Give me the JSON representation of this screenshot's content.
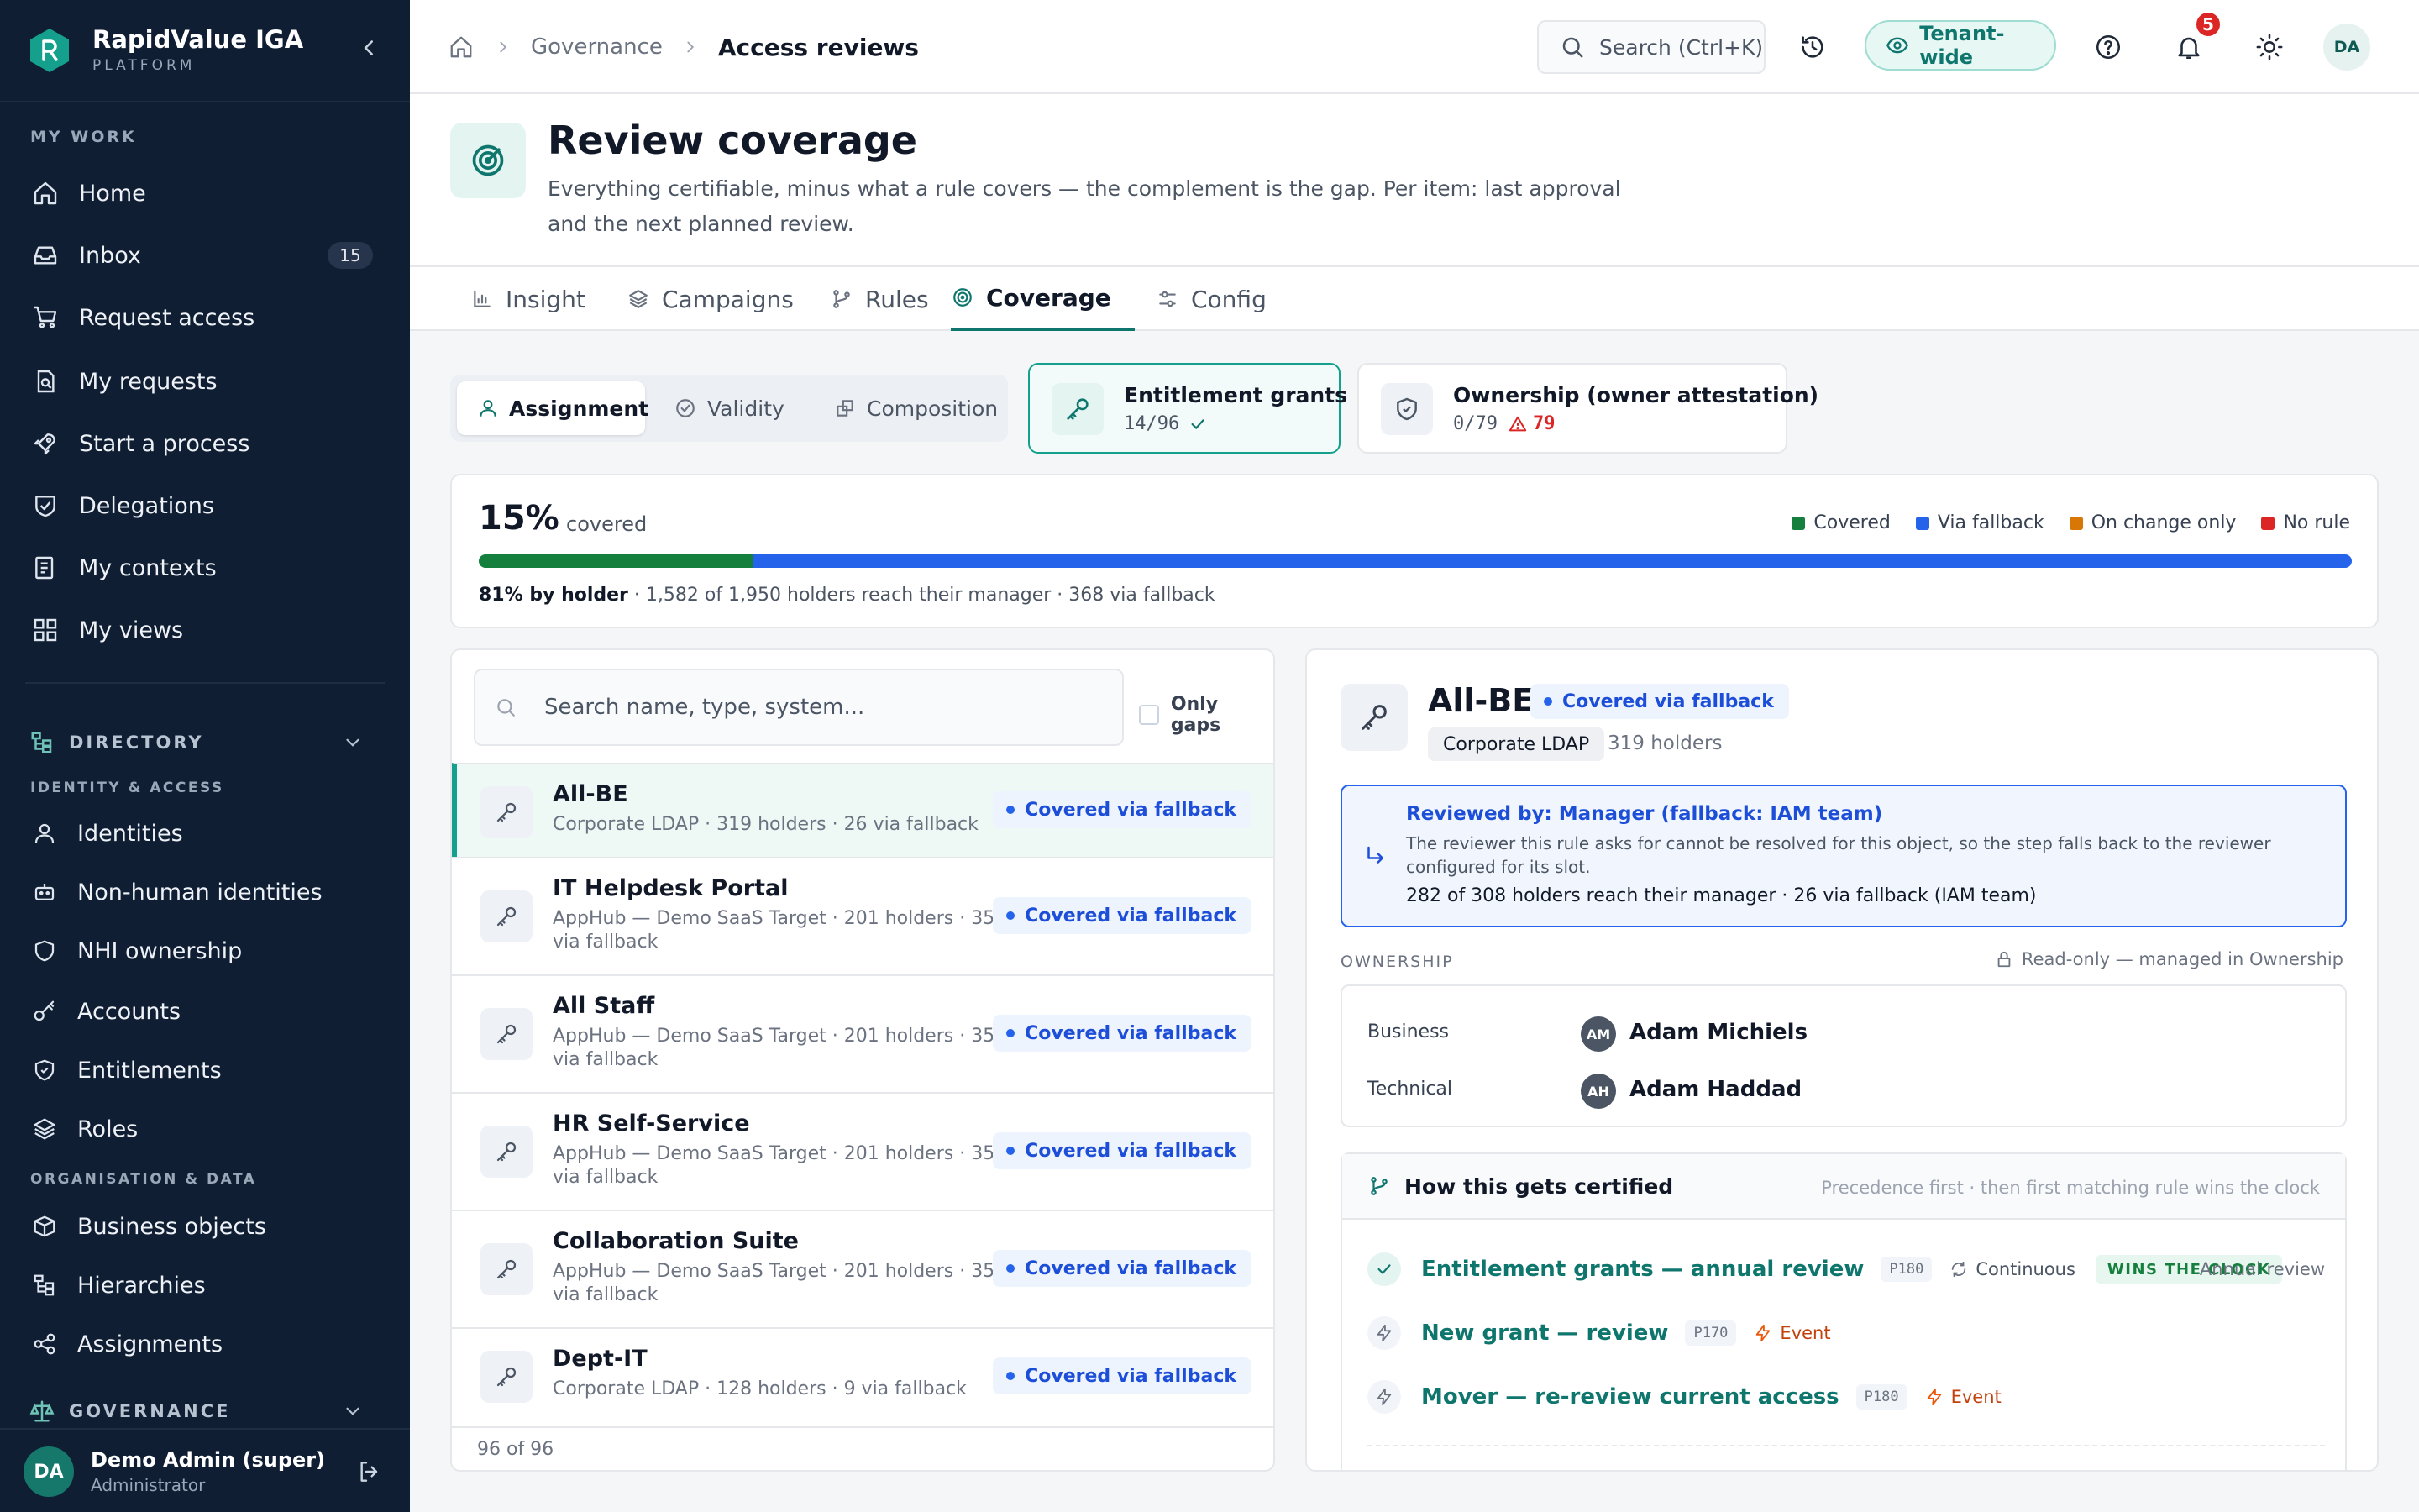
{
  "brand": {
    "name": "RapidValue IGA",
    "sub": "PLATFORM"
  },
  "sidebar": {
    "my_work_label": "MY WORK",
    "my_work": [
      {
        "label": "Home",
        "icon": "home-icon"
      },
      {
        "label": "Inbox",
        "icon": "inbox-icon",
        "badge": "15"
      },
      {
        "label": "Request access",
        "icon": "cart-icon"
      },
      {
        "label": "My requests",
        "icon": "requests-icon"
      },
      {
        "label": "Start a process",
        "icon": "rocket-icon"
      },
      {
        "label": "Delegations",
        "icon": "handshake-icon"
      },
      {
        "label": "My contexts",
        "icon": "contexts-icon"
      },
      {
        "label": "My views",
        "icon": "grid-icon"
      }
    ],
    "directory_label": "DIRECTORY",
    "identity_access_label": "IDENTITY & ACCESS",
    "identity_access": [
      {
        "label": "Identities",
        "icon": "user-icon"
      },
      {
        "label": "Non-human identities",
        "icon": "bot-icon"
      },
      {
        "label": "NHI ownership",
        "icon": "shield-icon"
      },
      {
        "label": "Accounts",
        "icon": "key-icon"
      },
      {
        "label": "Entitlements",
        "icon": "shield-check-icon"
      },
      {
        "label": "Roles",
        "icon": "layers-icon"
      }
    ],
    "org_data_label": "ORGANISATION & DATA",
    "org_data": [
      {
        "label": "Business objects",
        "icon": "box-icon"
      },
      {
        "label": "Hierarchies",
        "icon": "hierarchy-icon"
      },
      {
        "label": "Assignments",
        "icon": "share-icon"
      }
    ],
    "governance_label": "GOVERNANCE",
    "user": {
      "initials": "DA",
      "name": "Demo Admin (super)",
      "role": "Administrator"
    }
  },
  "topbar": {
    "breadcrumb": {
      "parent": "Governance",
      "current": "Access reviews"
    },
    "search_label": "Search (Ctrl+K)",
    "tenant_label": "Tenant-wide",
    "notifications_count": "5",
    "avatar_initials": "DA"
  },
  "page": {
    "title": "Review coverage",
    "description": "Everything certifiable, minus what a rule covers — the complement is the gap. Per item: last approval and the next planned review."
  },
  "tabs": [
    {
      "label": "Insight",
      "icon": "bar-chart-icon"
    },
    {
      "label": "Campaigns",
      "icon": "layers-icon"
    },
    {
      "label": "Rules",
      "icon": "branch-icon"
    },
    {
      "label": "Coverage",
      "icon": "target-icon",
      "active": true
    },
    {
      "label": "Config",
      "icon": "sliders-icon"
    }
  ],
  "segment": [
    {
      "label": "Assignment",
      "icon": "user-icon",
      "active": true
    },
    {
      "label": "Validity",
      "icon": "check-circle-icon"
    },
    {
      "label": "Composition",
      "icon": "composition-icon"
    }
  ],
  "cards": {
    "entitlement": {
      "title": "Entitlement grants",
      "value": "14/96"
    },
    "ownership": {
      "title": "Ownership (owner attestation)",
      "value": "0/79",
      "warn": "79"
    }
  },
  "coverage": {
    "percent": "15%",
    "percent_label": "covered",
    "covered_fraction": 0.146,
    "fallback_fraction": 0.854,
    "legend": [
      {
        "label": "Covered",
        "color": "#15803d"
      },
      {
        "label": "Via fallback",
        "color": "#2563eb"
      },
      {
        "label": "On change only",
        "color": "#d97706"
      },
      {
        "label": "No rule",
        "color": "#dc2626"
      }
    ],
    "by_holder": "81% by holder",
    "footnote": " · 1,582 of 1,950 holders reach their manager · 368 via fallback"
  },
  "list": {
    "search_placeholder": "Search name, type, system...",
    "only_gaps_label": "Only gaps",
    "rows": [
      {
        "name": "All-BE",
        "sub": "Corporate LDAP · 319 holders · 26 via fallback",
        "status": "Covered via fallback"
      },
      {
        "name": "IT Helpdesk Portal",
        "sub": "AppHub — Demo SaaS Target · 201 holders · 35 via fallback",
        "status": "Covered via fallback"
      },
      {
        "name": "All Staff",
        "sub": "AppHub — Demo SaaS Target · 201 holders · 35 via fallback",
        "status": "Covered via fallback"
      },
      {
        "name": "HR Self-Service",
        "sub": "AppHub — Demo SaaS Target · 201 holders · 35 via fallback",
        "status": "Covered via fallback"
      },
      {
        "name": "Collaboration Suite",
        "sub": "AppHub — Demo SaaS Target · 201 holders · 35 via fallback",
        "status": "Covered via fallback"
      },
      {
        "name": "Dept-IT",
        "sub": "Corporate LDAP · 128 holders · 9 via fallback",
        "status": "Covered via fallback"
      }
    ],
    "footer": "96 of 96"
  },
  "detail": {
    "name": "All-BE",
    "status": "Covered via fallback",
    "system": "Corporate LDAP",
    "holders": "319 holders",
    "reviewer": {
      "title": "Reviewed by: Manager (fallback: IAM team)",
      "desc": "The reviewer this rule asks for cannot be resolved for this object, so the step falls back to the reviewer configured for its slot.",
      "foot": "282 of 308 holders reach their manager · 26 via fallback (IAM team)"
    },
    "ownership_label": "OWNERSHIP",
    "ownership_readonly": "Read-only — managed in Ownership",
    "owners": [
      {
        "role": "Business",
        "initials": "AM",
        "name": "Adam Michiels"
      },
      {
        "role": "Technical",
        "initials": "AH",
        "name": "Adam Haddad"
      }
    ],
    "certified": {
      "title": "How this gets certified",
      "note": "Precedence first · then first matching rule wins the clock",
      "rules": [
        {
          "name": "Entitlement grants — annual review",
          "priority": "P180",
          "mode": "Continuous",
          "wins": "WINS THE CLOCK",
          "right": "Annual review"
        },
        {
          "name": "New grant — review",
          "priority": "P170",
          "event": "Event"
        },
        {
          "name": "Mover — re-review current access",
          "priority": "P180",
          "event": "Event"
        }
      ]
    }
  }
}
